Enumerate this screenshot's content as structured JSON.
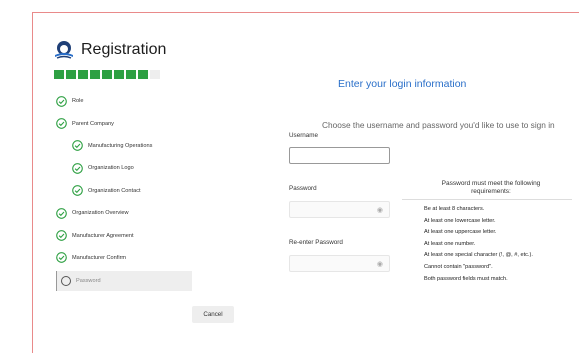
{
  "app": {
    "title": "Registration",
    "logo_icon": "lighthouse-logo-icon"
  },
  "progress": {
    "completed_segments": 8,
    "total_segments": 9,
    "color": "#2ea043"
  },
  "steps": [
    {
      "label": "Role",
      "status": "done",
      "sub": false
    },
    {
      "label": "Parent Company",
      "status": "done",
      "sub": false
    },
    {
      "label": "Manufacturing Operations",
      "status": "done",
      "sub": true
    },
    {
      "label": "Organization Logo",
      "status": "done",
      "sub": true
    },
    {
      "label": "Organization Contact",
      "status": "done",
      "sub": true
    },
    {
      "label": "Organization Overview",
      "status": "done",
      "sub": false
    },
    {
      "label": "Manufacturer Agreement",
      "status": "done",
      "sub": false
    },
    {
      "label": "Manufacturer Confirm",
      "status": "done",
      "sub": false
    },
    {
      "label": "Password",
      "status": "current",
      "sub": false
    }
  ],
  "main": {
    "title": "Enter your login information",
    "subtitle": "Choose the username and password you'd like to use to sign in",
    "username_label": "Username",
    "username_value": "",
    "password_label": "Password",
    "password_value": "",
    "reenter_label": "Re-enter Password",
    "reenter_value": ""
  },
  "requirements": {
    "heading": "Password must meet the following requirements:",
    "rules": [
      "Be at least 8 characters.",
      "At least one lowercase letter.",
      "At least one uppercase letter.",
      "At least one number.",
      "At least one special character (!, @, #, etc.).",
      "Cannot contain \"password\".",
      "Both password fields must match."
    ]
  },
  "footer": {
    "cancel_label": "Cancel"
  },
  "colors": {
    "accent_blue": "#2a6fc9",
    "success_green": "#2ea043",
    "frame_border": "#e98a8a"
  }
}
